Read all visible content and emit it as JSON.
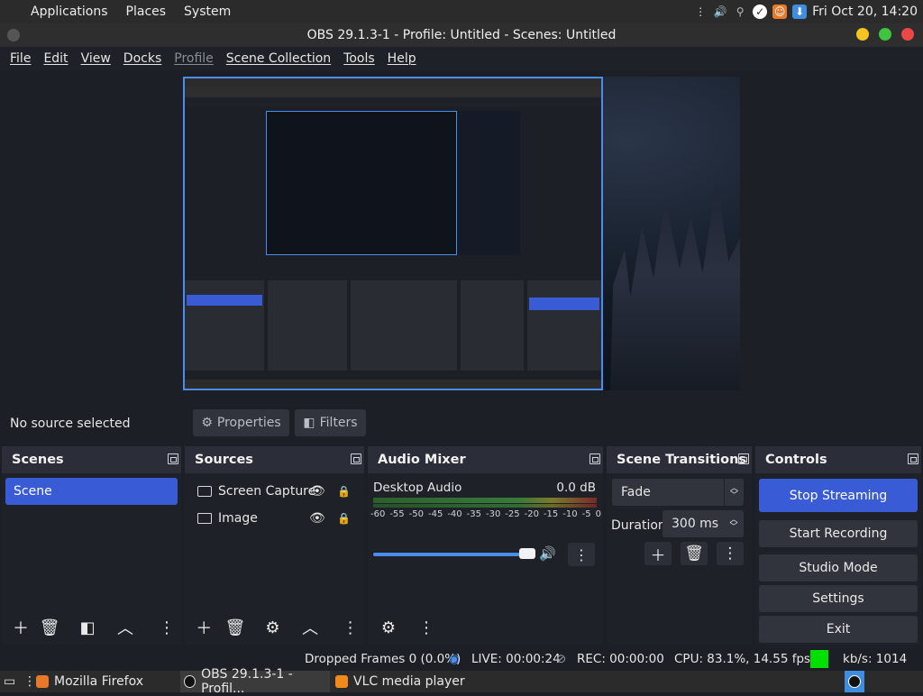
{
  "top_panel": {
    "menus": [
      "Applications",
      "Places",
      "System"
    ],
    "clock": "Fri Oct 20, 14:20"
  },
  "window": {
    "title": "OBS 29.1.3-1 - Profile: Untitled - Scenes: Untitled"
  },
  "menubar": {
    "items": [
      "File",
      "Edit",
      "View",
      "Docks",
      "Profile",
      "Scene Collection",
      "Tools",
      "Help"
    ]
  },
  "properties_bar": {
    "no_source": "No source selected",
    "properties_label": "Properties",
    "filters_label": "Filters"
  },
  "docks": {
    "scenes": {
      "title": "Scenes",
      "items": [
        "Scene"
      ]
    },
    "sources": {
      "title": "Sources",
      "items": [
        {
          "label": "Screen Capture"
        },
        {
          "label": "Image"
        }
      ]
    },
    "audio_mixer": {
      "title": "Audio Mixer",
      "channel_name": "Desktop Audio",
      "channel_db": "0.0 dB",
      "ticks": [
        "-60",
        "-55",
        "-50",
        "-45",
        "-40",
        "-35",
        "-30",
        "-25",
        "-20",
        "-15",
        "-10",
        "-5",
        "0"
      ]
    },
    "scene_transitions": {
      "title": "Scene Transitions",
      "transition": "Fade",
      "duration_label": "Duration",
      "duration_value": "300 ms"
    },
    "controls": {
      "title": "Controls",
      "stop_streaming": "Stop Streaming",
      "start_recording": "Start Recording",
      "studio_mode": "Studio Mode",
      "settings": "Settings",
      "exit": "Exit"
    }
  },
  "statusbar": {
    "dropped_frames": "Dropped Frames 0 (0.0%)",
    "live": "LIVE: 00:00:24",
    "rec": "REC: 00:00:00",
    "cpu": "CPU: 83.1%, 14.55 fps",
    "kbs": "kb/s: 1014",
    "status_color": "#00e000"
  },
  "taskbar": {
    "items": [
      "Mozilla Firefox",
      "OBS 29.1.3-1 - Profil...",
      "VLC media player"
    ]
  },
  "colors": {
    "accent": "#3a5bd6",
    "preview_border": "#4a8cf0"
  }
}
